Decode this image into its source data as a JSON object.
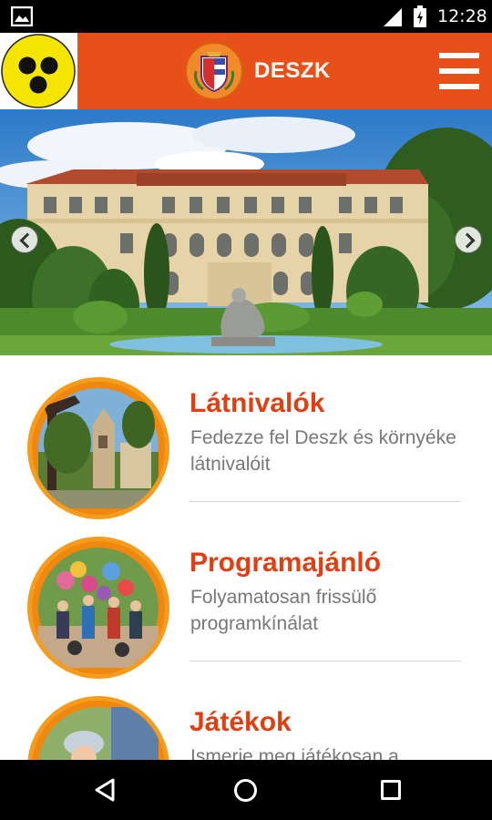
{
  "status_bar": {
    "time": "12:28",
    "icons": [
      "notification-image-icon",
      "signal-icon",
      "battery-icon"
    ]
  },
  "app_bar": {
    "brand_name": "DESZK",
    "accessibility_icon": "accessibility-icon",
    "menu_icon": "hamburger-menu-icon",
    "accent_color": "#e8501a"
  },
  "hero": {
    "prev_icon": "chevron-left-icon",
    "next_icon": "chevron-right-icon"
  },
  "features": [
    {
      "title": "Látnivalók",
      "description": "Fedezze fel Deszk és környéke látnivalóit"
    },
    {
      "title": "Programajánló",
      "description": "Folyamatosan frissülő programkínálat"
    },
    {
      "title": "Játékok",
      "description": "Ismerje meg játékosan a"
    }
  ],
  "nav_bar": {
    "icons": [
      "back-icon",
      "home-icon",
      "recent-apps-icon"
    ]
  }
}
